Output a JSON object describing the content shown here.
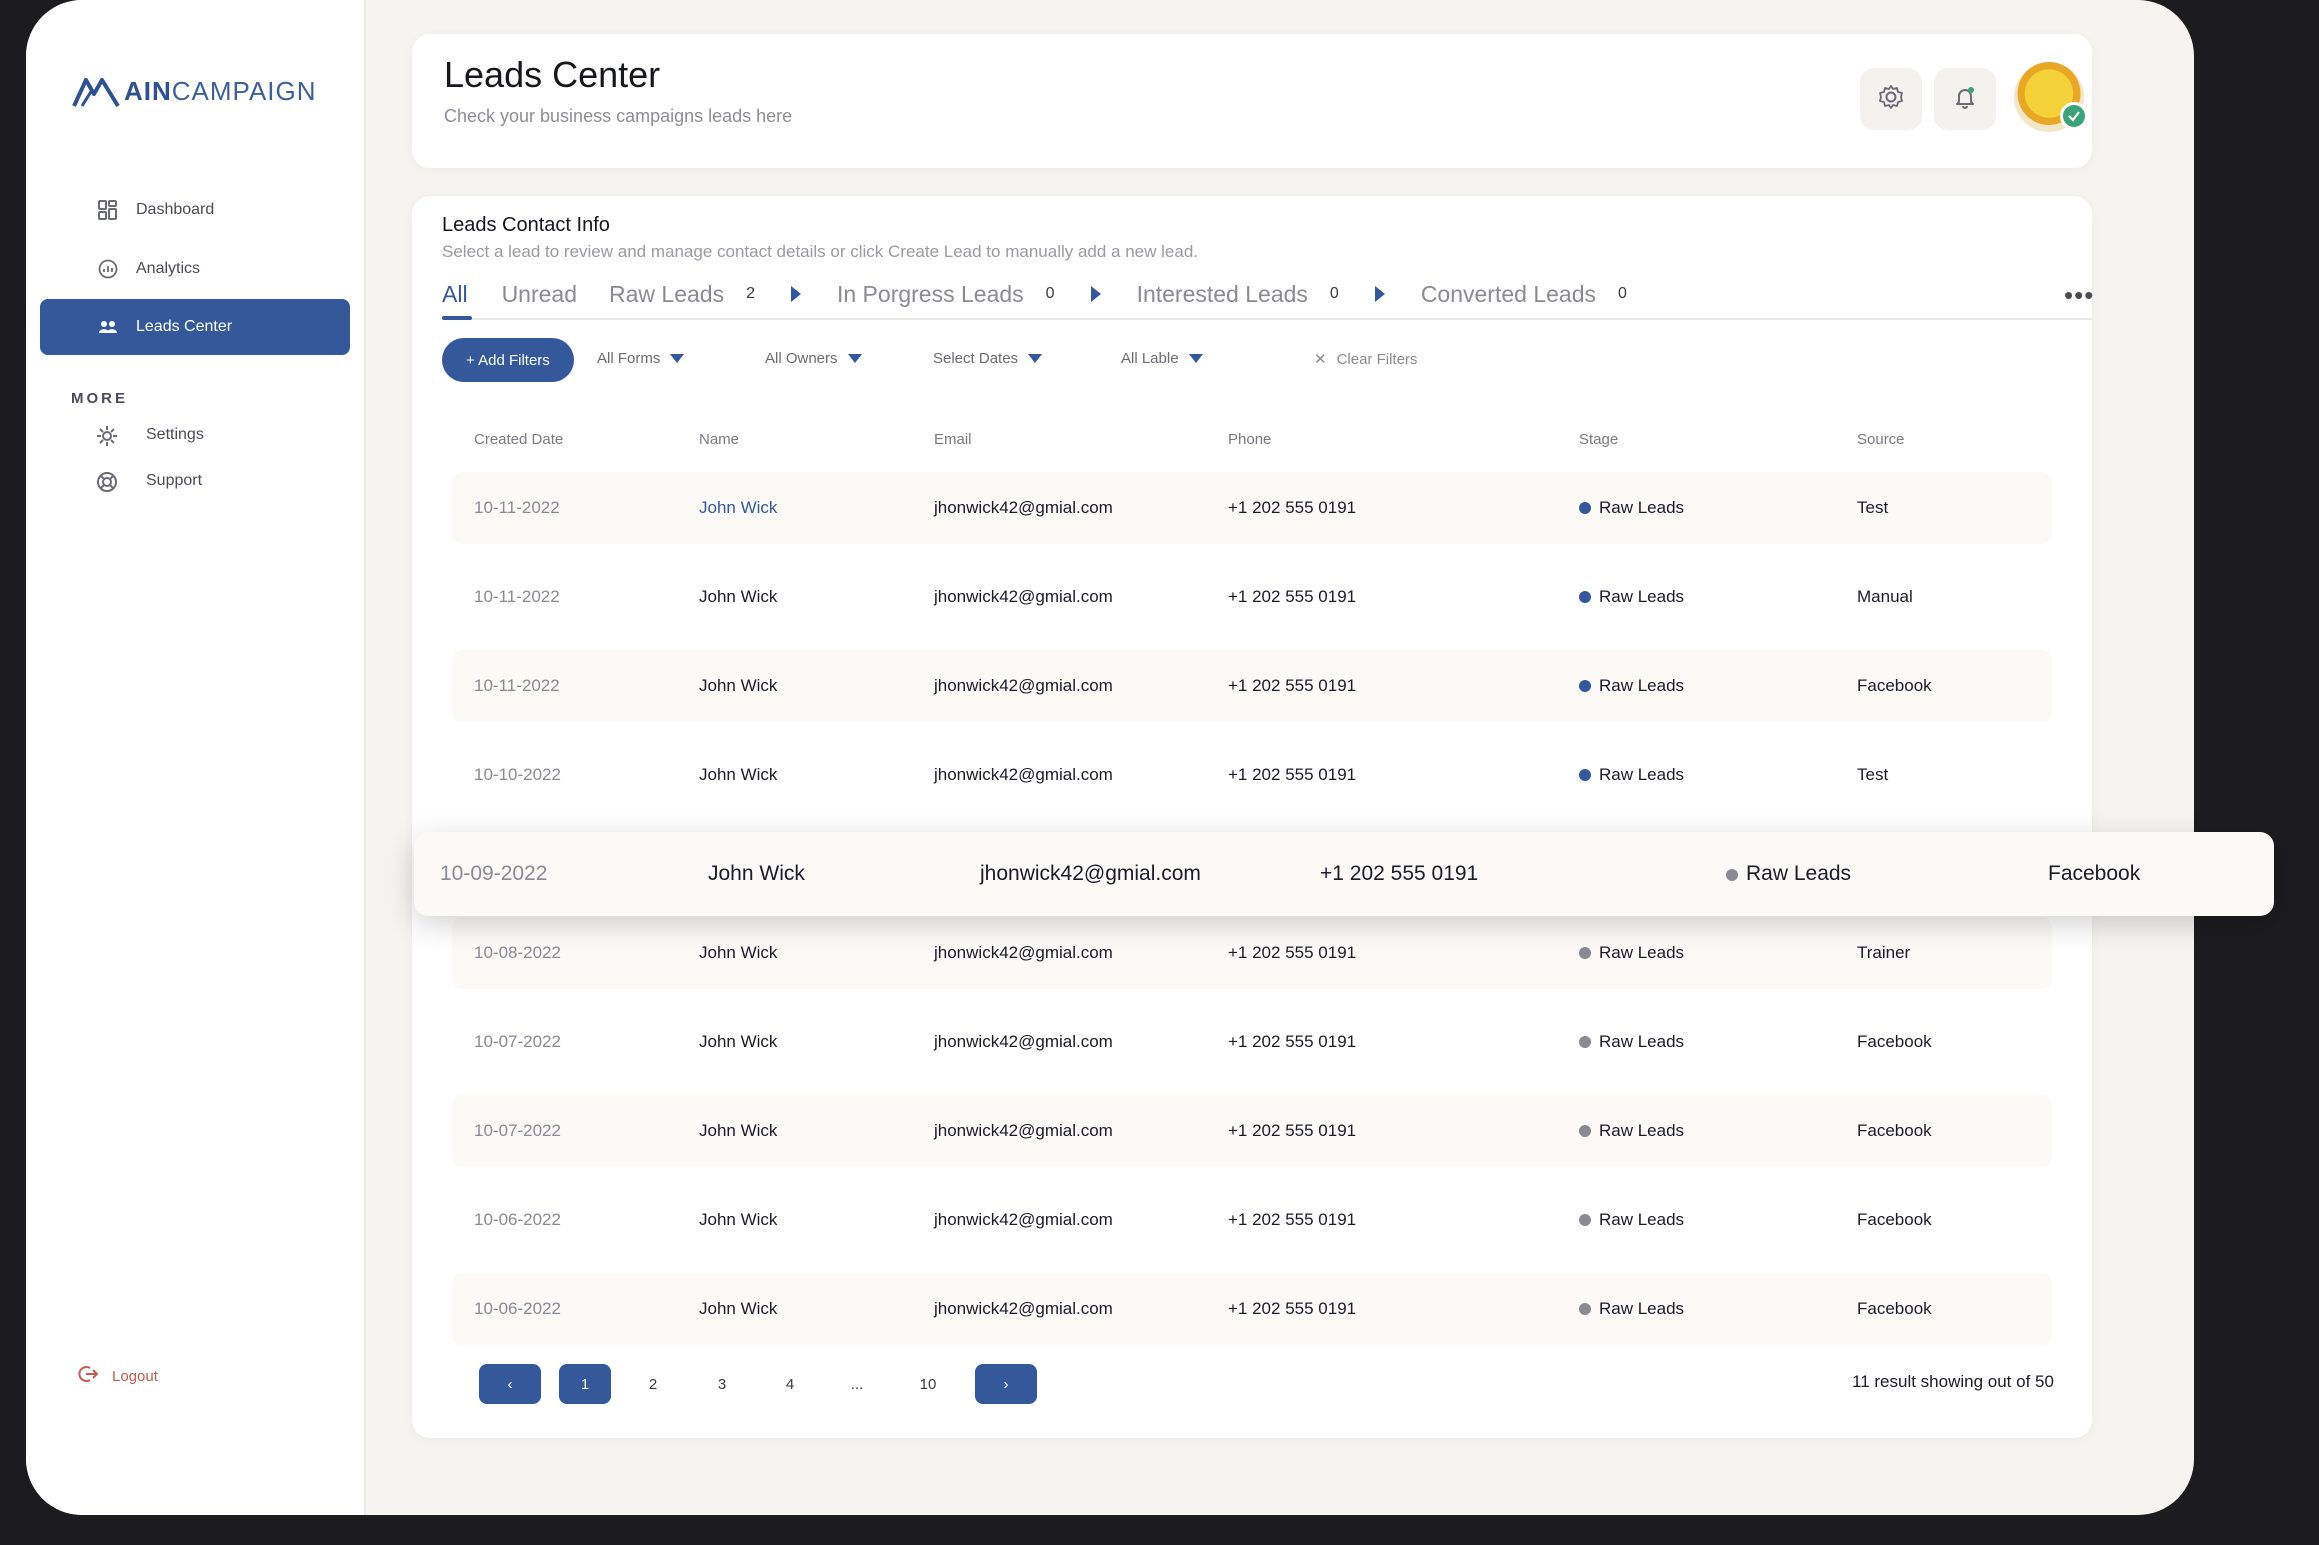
{
  "brand": {
    "logo_bold": "AIN",
    "logo_light": "CAMPAIGN",
    "accent": "#34589a"
  },
  "sidebar": {
    "items": [
      {
        "label": "Dashboard",
        "icon": "dashboard-grid-icon"
      },
      {
        "label": "Analytics",
        "icon": "analytics-icon"
      },
      {
        "label": "Leads Center",
        "icon": "leads-people-icon",
        "active": true
      }
    ],
    "more_title": "MORE",
    "more_items": [
      {
        "label": "Settings",
        "icon": "settings-gear-icon"
      },
      {
        "label": "Support",
        "icon": "support-lifebuoy-icon"
      }
    ],
    "logout": "Logout"
  },
  "header": {
    "title": "Leads Center",
    "subtitle": "Check your business campaigns leads here",
    "icons": [
      "gear-icon",
      "bell-icon",
      "avatar"
    ]
  },
  "leads": {
    "title": "Leads Contact Info",
    "description": "Select a lead to review and manage contact details or click Create Lead to manually add a new lead.",
    "tabs": [
      {
        "label": "All",
        "active": true
      },
      {
        "label": "Unread"
      },
      {
        "label": "Raw Leads",
        "count": "2"
      },
      {
        "label": "In Porgress Leads",
        "count": "0"
      },
      {
        "label": "Interested Leads",
        "count": "0"
      },
      {
        "label": "Converted Leads",
        "count": "0"
      }
    ],
    "filters": {
      "add": "+ Add Filters",
      "forms": "All Forms",
      "owners": "All Owners",
      "dates": "Select Dates",
      "label": "All Lable",
      "clear": "Clear Filters"
    },
    "columns": [
      "Created Date",
      "Name",
      "Email",
      "Phone",
      "Stage",
      "Source"
    ],
    "rows": [
      {
        "date": "10-11-2022",
        "name": "John Wick",
        "email": "jhonwick42@gmial.com",
        "phone": "+1 202 555 0191",
        "stage": "Raw Leads",
        "source": "Test",
        "dot": "#34589a"
      },
      {
        "date": "10-11-2022",
        "name": "John Wick",
        "email": "jhonwick42@gmial.com",
        "phone": "+1 202 555 0191",
        "stage": "Raw Leads",
        "source": "Manual",
        "dot": "#34589a"
      },
      {
        "date": "10-11-2022",
        "name": "John Wick",
        "email": "jhonwick42@gmial.com",
        "phone": "+1 202 555 0191",
        "stage": "Raw Leads",
        "source": "Facebook",
        "dot": "#34589a"
      },
      {
        "date": "10-10-2022",
        "name": "John Wick",
        "email": "jhonwick42@gmial.com",
        "phone": "+1 202 555 0191",
        "stage": "Raw Leads",
        "source": "Test",
        "dot": "#34589a"
      },
      {
        "date": "10-09-2022",
        "name": "John Wick",
        "email": "jhonwick42@gmial.com",
        "phone": "+1 202 555 0191",
        "stage": "Raw Leads",
        "source": "Facebook",
        "dot": "#8a8a94"
      },
      {
        "date": "10-08-2022",
        "name": "John Wick",
        "email": "jhonwick42@gmial.com",
        "phone": "+1 202 555 0191",
        "stage": "Raw Leads",
        "source": "Trainer",
        "dot": "#8a8a94"
      },
      {
        "date": "10-07-2022",
        "name": "John Wick",
        "email": "jhonwick42@gmial.com",
        "phone": "+1 202 555 0191",
        "stage": "Raw Leads",
        "source": "Facebook",
        "dot": "#8a8a94"
      },
      {
        "date": "10-07-2022",
        "name": "John Wick",
        "email": "jhonwick42@gmial.com",
        "phone": "+1 202 555 0191",
        "stage": "Raw Leads",
        "source": "Facebook",
        "dot": "#8a8a94"
      },
      {
        "date": "10-06-2022",
        "name": "John Wick",
        "email": "jhonwick42@gmial.com",
        "phone": "+1 202 555 0191",
        "stage": "Raw Leads",
        "source": "Facebook",
        "dot": "#8a8a94"
      },
      {
        "date": "10-06-2022",
        "name": "John Wick",
        "email": "jhonwick42@gmial.com",
        "phone": "+1 202 555 0191",
        "stage": "Raw Leads",
        "source": "Facebook",
        "dot": "#8a8a94"
      }
    ],
    "pagination": {
      "pages": [
        "1",
        "2",
        "3",
        "4",
        "...",
        "10"
      ],
      "current": "1",
      "result_text": "11 result showing out of 50"
    }
  }
}
